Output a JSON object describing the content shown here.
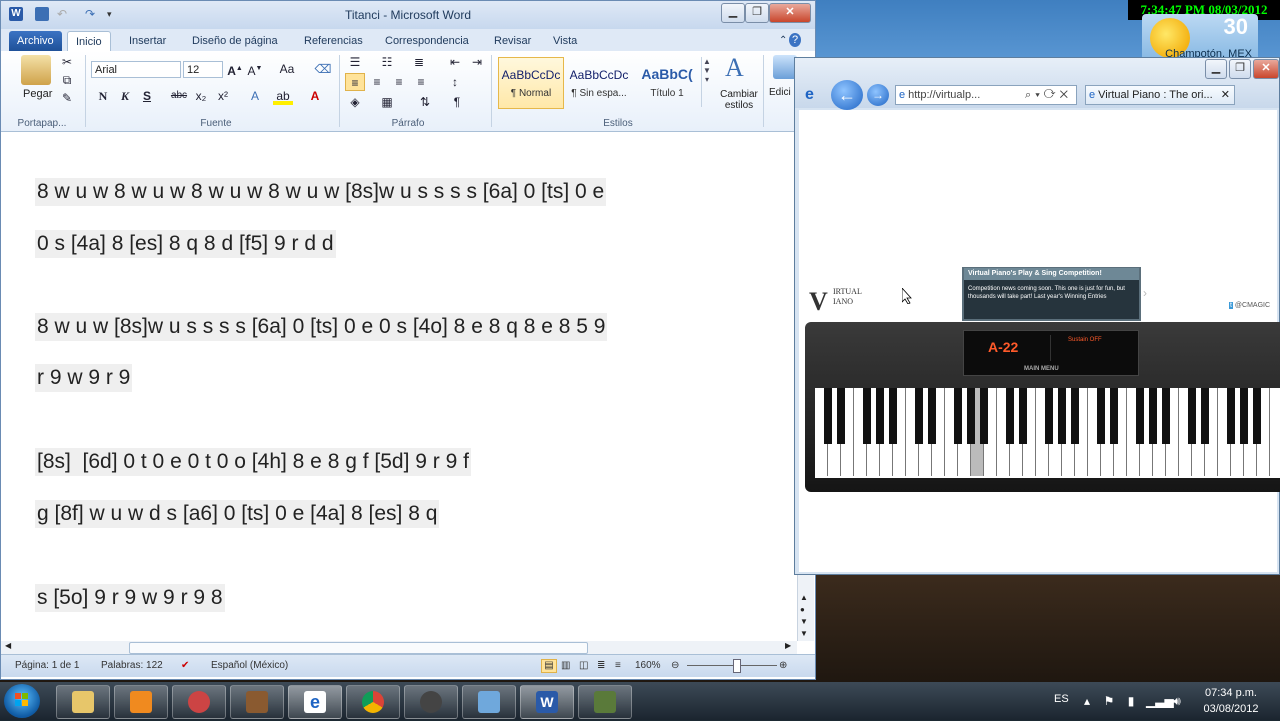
{
  "desktop": {
    "clock_overlay": "7:34:47 PM 08/03/2012",
    "weather": {
      "temp": "30",
      "city": "Champotón, MEX"
    }
  },
  "word": {
    "title": "Titanci - Microsoft Word",
    "tabs": [
      "Archivo",
      "Inicio",
      "Insertar",
      "Diseño de página",
      "Referencias",
      "Correspondencia",
      "Revisar",
      "Vista"
    ],
    "ribbon": {
      "paste_label": "Pegar",
      "font_name": "Arial",
      "font_size": "12",
      "styles": [
        {
          "sample": "AaBbCcDc",
          "name": "¶ Normal"
        },
        {
          "sample": "AaBbCcDc",
          "name": "¶ Sin espa..."
        },
        {
          "sample": "AaBbC(",
          "name": "Título 1"
        }
      ],
      "change_styles_line1": "Cambiar",
      "change_styles_line2": "estilos",
      "edit_label": "Edici",
      "groups": [
        "Portapap...",
        "Fuente",
        "Párrafo",
        "Estilos"
      ]
    },
    "document_lines": [
      "8 w u w 8 w u w 8 w u w 8 w u w [8s]w u s s s s [6a] 0 [ts] 0 e",
      "0 s [4a] 8 [es] 8 q 8 d [f5] 9 r d d",
      "8 w u w [8s]w u s s s s [6a] 0 [ts] 0 e 0 s [4o] 8 e 8 q 8 e 8 5 9",
      "r 9 w 9 r 9",
      "[8s]  [6d] 0 t 0 e 0 t 0 o [4h] 8 e 8 g f [5d] 9 r 9 f",
      "g [8f] w u w d s [a6] 0 [ts] 0 e [4a] 8 [es] 8 q",
      "s [5o] 9 r 9 w 9 r 9 8"
    ],
    "status": {
      "page": "Página: 1 de 1",
      "words": "Palabras: 122",
      "language": "Español (México)",
      "zoom": "160%"
    }
  },
  "ie": {
    "address": "http://virtualp...",
    "tab_title": "Virtual Piano : The ori...",
    "banner_title": "Virtual Piano's Play & Sing Competition!",
    "banner_text": "Competition news coming soon. This one is just for fun, but thousands will take part! Last year's Winning Entries",
    "logo_line1": "IRTUAL",
    "logo_line2": "IANO",
    "twitter": "@CMAGIC",
    "piano_note": "A-22",
    "sustain": "Sustain OFF",
    "main_menu": "MAIN MENU"
  },
  "taskbar": {
    "lang": "ES",
    "time": "07:34 p.m.",
    "date": "03/08/2012"
  }
}
